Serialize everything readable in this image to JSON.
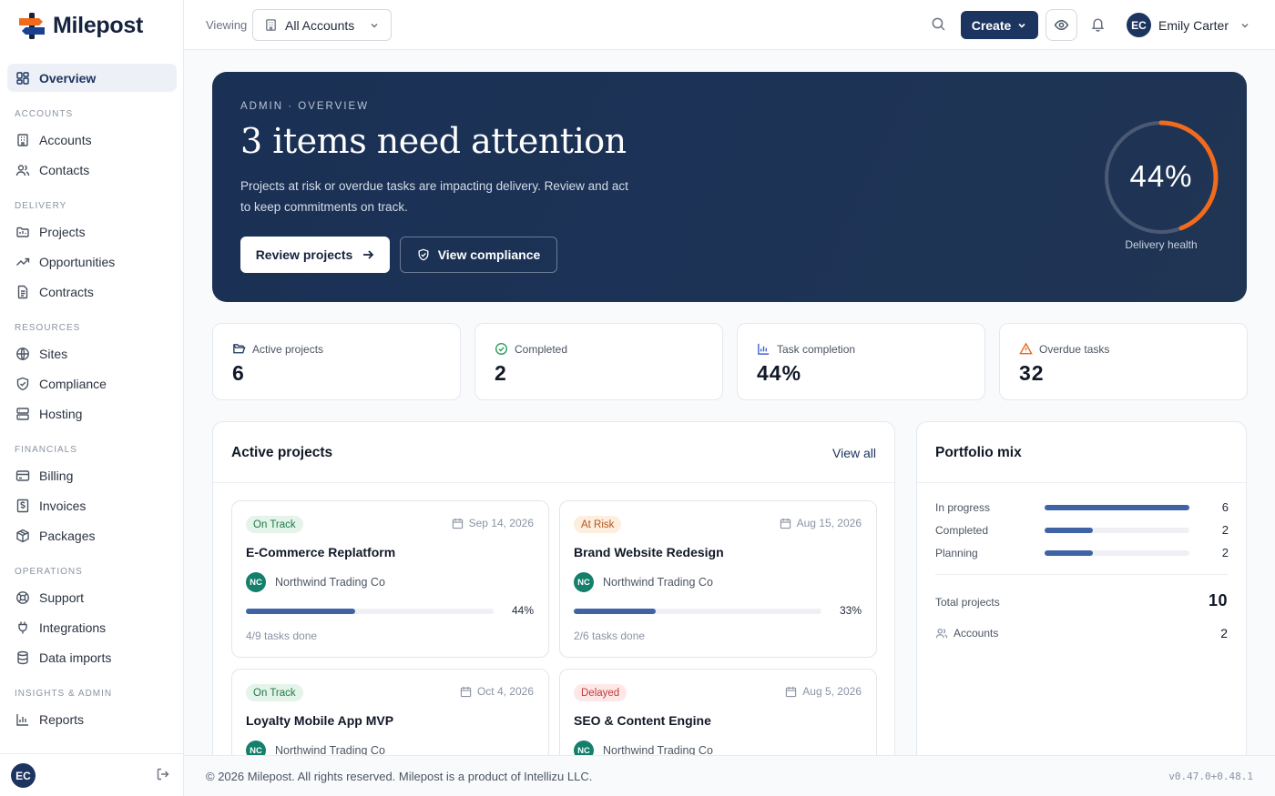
{
  "app": {
    "name": "Milepost"
  },
  "sidebar": {
    "overview": "Overview",
    "sections": {
      "accounts": "ACCOUNTS",
      "delivery": "DELIVERY",
      "resources": "RESOURCES",
      "financials": "FINANCIALS",
      "operations": "OPERATIONS",
      "insights": "INSIGHTS & ADMIN"
    },
    "items": {
      "accounts": "Accounts",
      "contacts": "Contacts",
      "projects": "Projects",
      "opportunities": "Opportunities",
      "contracts": "Contracts",
      "sites": "Sites",
      "compliance": "Compliance",
      "hosting": "Hosting",
      "billing": "Billing",
      "invoices": "Invoices",
      "packages": "Packages",
      "support": "Support",
      "integrations": "Integrations",
      "data_imports": "Data imports",
      "reports": "Reports"
    },
    "user_initials": "EC"
  },
  "topbar": {
    "viewing_label": "Viewing",
    "account_select": "All Accounts",
    "create_label": "Create",
    "user_initials": "EC",
    "user_name": "Emily Carter"
  },
  "hero": {
    "eyebrow": "ADMIN · OVERVIEW",
    "title": "3 items need attention",
    "description": "Projects at risk or overdue tasks are impacting delivery. Review and act to keep commitments on track.",
    "primary_button": "Review projects",
    "secondary_button": "View compliance",
    "gauge_value": "44%",
    "gauge_fraction": 0.44,
    "gauge_label": "Delivery health"
  },
  "stats": [
    {
      "label": "Active projects",
      "value": "6"
    },
    {
      "label": "Completed",
      "value": "2"
    },
    {
      "label": "Task completion",
      "value": "44%"
    },
    {
      "label": "Overdue tasks",
      "value": "32"
    }
  ],
  "active_projects": {
    "title": "Active projects",
    "view_all": "View all",
    "projects": [
      {
        "status": "On Track",
        "date": "Sep 14, 2026",
        "name": "E-Commerce Replatform",
        "client_initials": "NC",
        "client": "Northwind Trading Co",
        "progress": 0.44,
        "progress_label": "44%",
        "tasks": "4/9 tasks done"
      },
      {
        "status": "At Risk",
        "date": "Aug 15, 2026",
        "name": "Brand Website Redesign",
        "client_initials": "NC",
        "client": "Northwind Trading Co",
        "progress": 0.33,
        "progress_label": "33%",
        "tasks": "2/6 tasks done"
      },
      {
        "status": "On Track",
        "date": "Oct 4, 2026",
        "name": "Loyalty Mobile App MVP",
        "client_initials": "NC",
        "client": "Northwind Trading Co"
      },
      {
        "status": "Delayed",
        "date": "Aug 5, 2026",
        "name": "SEO & Content Engine",
        "client_initials": "NC",
        "client": "Northwind Trading Co"
      }
    ]
  },
  "portfolio": {
    "title": "Portfolio mix",
    "rows": [
      {
        "label": "In progress",
        "value": "6",
        "fraction": 1.0
      },
      {
        "label": "Completed",
        "value": "2",
        "fraction": 0.333
      },
      {
        "label": "Planning",
        "value": "2",
        "fraction": 0.333
      }
    ],
    "total_label": "Total projects",
    "total_value": "10",
    "accounts_label": "Accounts",
    "accounts_value": "2"
  },
  "footer": {
    "copyright": "© 2026 Milepost. All rights reserved. Milepost is a product of Intellizu LLC.",
    "version": "v0.47.0+0.48.1"
  },
  "colors": {
    "brand_navy": "#1c3460",
    "accent_orange": "#f26a1b",
    "progress_blue": "#3f63a5",
    "client_teal": "#14806b"
  }
}
